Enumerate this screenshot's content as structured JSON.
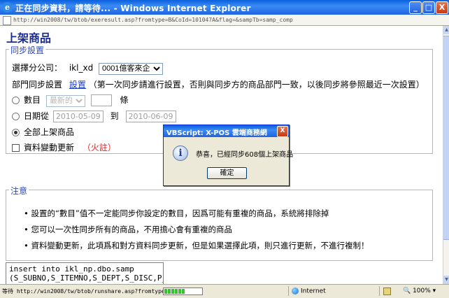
{
  "window": {
    "title": "正在同步資料，請等待... - Windows Internet Explorer",
    "min_glyph": "_",
    "max_glyph": "□",
    "close_glyph": "X",
    "ie_glyph": "e"
  },
  "address": {
    "url": "http://win2008/tw/btob/exeresult.asp?fromtype=B&CoId=101047A&flag=&sampTb=samp_comp"
  },
  "page": {
    "title": "上架商品",
    "sync_legend": "同步設置",
    "branch_label": "選擇分公司：",
    "branch_code": "ikl_xd",
    "branch_selected": "0001億客來企",
    "dept_label": "部門同步設置",
    "dept_link": "設置",
    "dept_note": "（第一次同步請進行設置，否則與同步方的商品部門一致，以後同步將參照最近一次設置）",
    "count_label": "數目",
    "count_select": "最新的",
    "count_unit": "條",
    "date_label": "日期從",
    "date_from": "2010-05-09",
    "date_to_label": "到",
    "date_to": "2010-06-09",
    "all_label": "全部上架商品",
    "update_label": "資料變動更新",
    "update_note": "（火註）",
    "notes_legend": "注意",
    "notes": [
      "設置的“數目”值不一定能同步你設定的數目，因爲可能有重複的商品，系統將排除掉",
      "您可以一次性同步所有的商品，不用擔心會有重複的商品",
      "資料變動更新，此項爲和對方資料同步更新，但是如果選擇此項，則只進行更新，不進行複制！"
    ],
    "sql_lines": [
      "insert into ikl_np.dbo.samp",
      "(S_SUBNO,S_ITEMNO,S_DEPT,S_DISC,P_"
    ]
  },
  "dialog": {
    "title": "VBScript: X-POS 雲端商務網",
    "message": "恭喜，已經同步608個上架商品",
    "ok_label": "確定",
    "close_glyph": "X",
    "icon_glyph": "i"
  },
  "status": {
    "message": "等待 http://win2008/tw/btob/runshare.asp?fromtype=",
    "progress": 0.55,
    "zone": "Internet",
    "zoom": "100%"
  }
}
